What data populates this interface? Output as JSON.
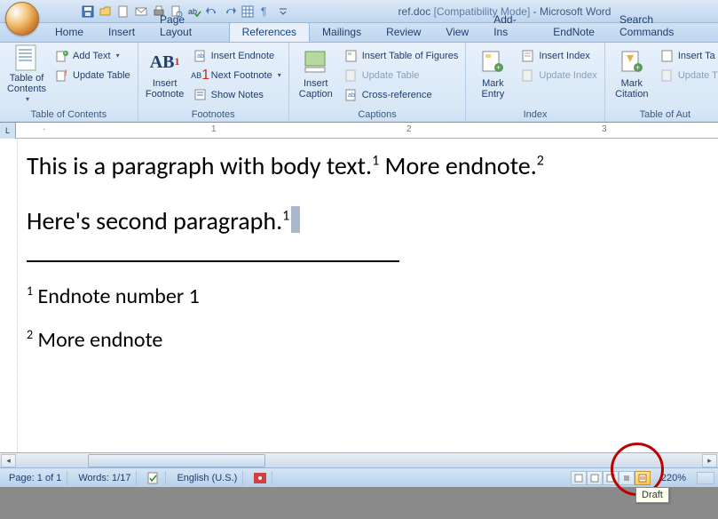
{
  "title": {
    "doc": "ref.doc",
    "mode": "[Compatibility Mode]",
    "app": "Microsoft Word"
  },
  "tabs": [
    "Home",
    "Insert",
    "Page Layout",
    "References",
    "Mailings",
    "Review",
    "View",
    "Add-Ins",
    "EndNote",
    "Search Commands"
  ],
  "active_tab": 3,
  "ribbon": {
    "toc": {
      "big": "Table of\nContents",
      "add_text": "Add Text",
      "update": "Update Table",
      "label": "Table of Contents"
    },
    "fn": {
      "big": "Insert\nFootnote",
      "ab": "AB",
      "ins_end": "Insert Endnote",
      "next": "Next Footnote",
      "show": "Show Notes",
      "label": "Footnotes"
    },
    "cap": {
      "big": "Insert\nCaption",
      "tof": "Insert Table of Figures",
      "upd": "Update Table",
      "xref": "Cross-reference",
      "label": "Captions"
    },
    "idx": {
      "big": "Mark\nEntry",
      "ins": "Insert Index",
      "upd": "Update Index",
      "label": "Index"
    },
    "cit": {
      "big": "Mark\nCitation",
      "ins": "Insert Ta",
      "upd": "Update T",
      "label": "Table of Aut"
    }
  },
  "ruler": {
    "marks": [
      "1",
      "2",
      "3"
    ]
  },
  "doc": {
    "p1a": "This is a paragraph with body text.",
    "p1b": "  More endnote.",
    "r1": "1",
    "r2": "2",
    "p2": "Here's second paragraph.",
    "r3": "1",
    "en1": "Endnote number 1",
    "en2": "More endnote"
  },
  "status": {
    "page": "Page: 1 of 1",
    "words": "Words: 1/17",
    "lang": "English (U.S.)",
    "zoom": "220%"
  },
  "tooltip": "Draft"
}
